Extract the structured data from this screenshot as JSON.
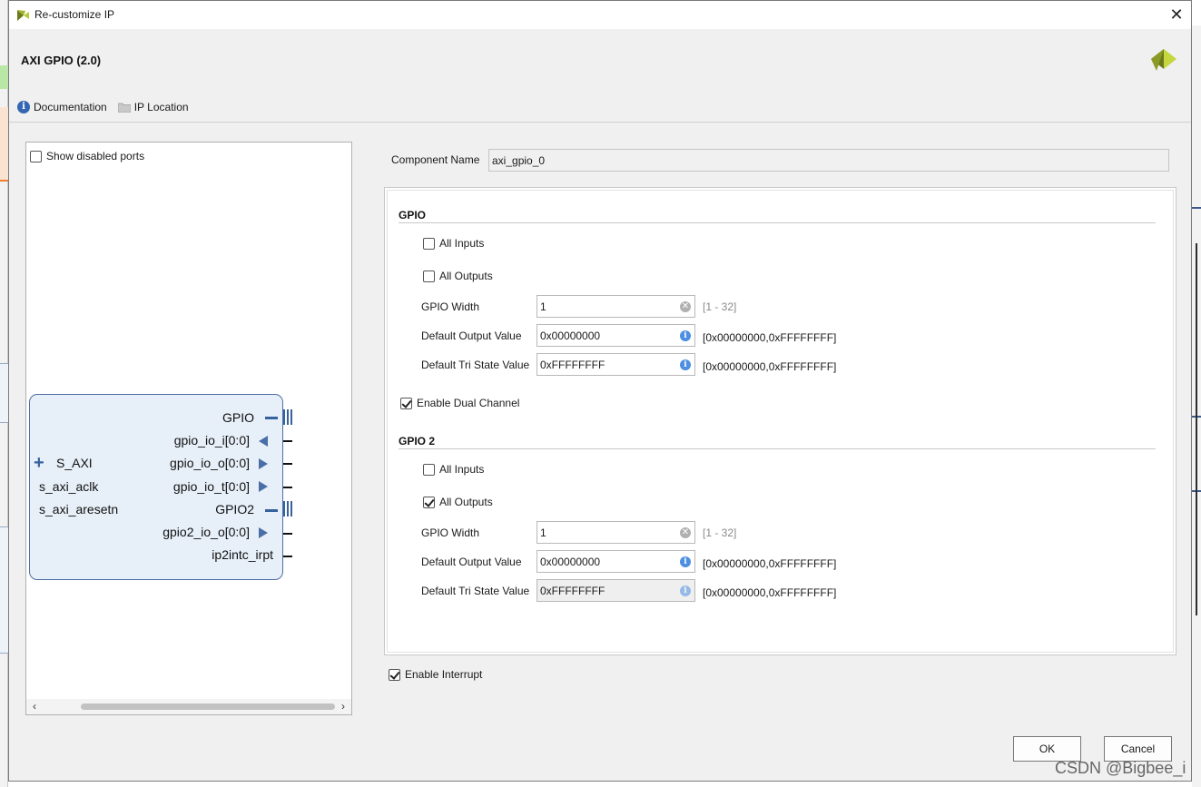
{
  "window": {
    "title": "Re-customize IP",
    "close_glyph": "✕"
  },
  "header": {
    "ip_title": "AXI GPIO (2.0)",
    "links": [
      {
        "label": "Documentation",
        "icon": "info-icon"
      },
      {
        "label": "IP Location",
        "icon": "folder-icon"
      }
    ]
  },
  "left_panel": {
    "show_disabled_label": "Show disabled ports",
    "show_disabled_checked": false,
    "block": {
      "left_ports": [
        "S_AXI",
        "s_axi_aclk",
        "s_axi_aresetn"
      ],
      "right_ports": [
        "GPIO",
        "gpio_io_i[0:0]",
        "gpio_io_o[0:0]",
        "gpio_io_t[0:0]",
        "GPIO2",
        "gpio2_io_o[0:0]",
        "ip2intc_irpt"
      ]
    }
  },
  "component": {
    "label": "Component Name",
    "value": "axi_gpio_0"
  },
  "gpio": {
    "title": "GPIO",
    "all_inputs": {
      "label": "All Inputs",
      "checked": false
    },
    "all_outputs": {
      "label": "All Outputs",
      "checked": false
    },
    "width": {
      "label": "GPIO Width",
      "value": "1",
      "range": "[1 - 32]"
    },
    "default_output": {
      "label": "Default Output Value",
      "value": "0x00000000",
      "range": "[0x00000000,0xFFFFFFFF]"
    },
    "default_tri": {
      "label": "Default Tri State Value",
      "value": "0xFFFFFFFF",
      "range": "[0x00000000,0xFFFFFFFF]"
    }
  },
  "dual_channel": {
    "label": "Enable Dual Channel",
    "checked": true
  },
  "gpio2": {
    "title": "GPIO 2",
    "all_inputs": {
      "label": "All Inputs",
      "checked": false
    },
    "all_outputs": {
      "label": "All Outputs",
      "checked": true
    },
    "width": {
      "label": "GPIO Width",
      "value": "1",
      "range": "[1 - 32]"
    },
    "default_output": {
      "label": "Default Output Value",
      "value": "0x00000000",
      "range": "[0x00000000,0xFFFFFFFF]"
    },
    "default_tri": {
      "label": "Default Tri State Value",
      "value": "0xFFFFFFFF",
      "range": "[0x00000000,0xFFFFFFFF]"
    }
  },
  "interrupt": {
    "label": "Enable Interrupt",
    "checked": true
  },
  "buttons": {
    "ok": "OK",
    "cancel": "Cancel"
  },
  "watermark": "CSDN @Bigbee_i",
  "colors": {
    "xilinx_dark": "#6b7a1b",
    "xilinx_light": "#b7c93a",
    "block_fill": "#e7eff8",
    "block_border": "#4f6fa3",
    "pin_blue": "#4a6fa8"
  }
}
